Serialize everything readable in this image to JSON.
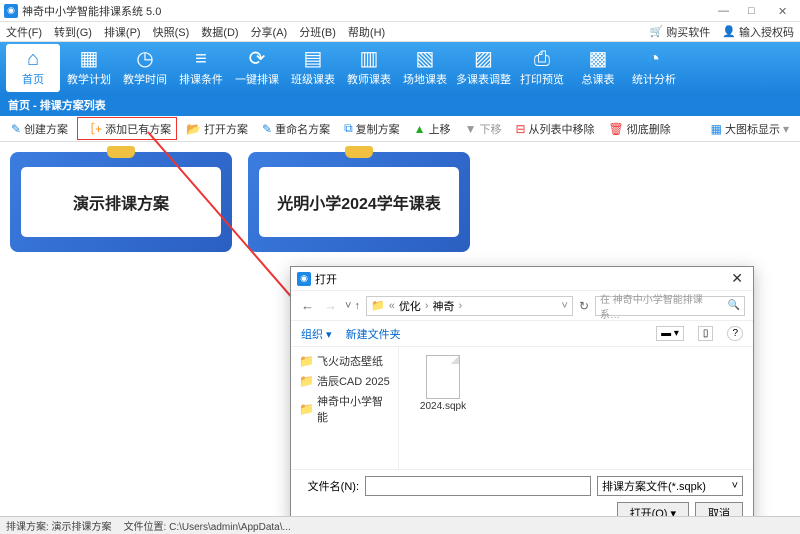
{
  "app": {
    "title": "神奇中小学智能排课系统 5.0"
  },
  "menu": {
    "file": "文件(F)",
    "goto": "转到(G)",
    "schedule": "排课(P)",
    "quick": "快照(S)",
    "data": "数据(D)",
    "share": "分享(A)",
    "league": "分班(B)",
    "help": "帮助(H)",
    "buy": "购买软件",
    "auth": "输入授权码"
  },
  "toolbar": [
    {
      "label": "首页",
      "icon": "⌂"
    },
    {
      "label": "教学计划",
      "icon": "▦"
    },
    {
      "label": "教学时间",
      "icon": "◷"
    },
    {
      "label": "排课条件",
      "icon": "≡"
    },
    {
      "label": "一键排课",
      "icon": "⟳"
    },
    {
      "label": "班级课表",
      "icon": "▤"
    },
    {
      "label": "教师课表",
      "icon": "▥"
    },
    {
      "label": "场地课表",
      "icon": "▧"
    },
    {
      "label": "多课表调整",
      "icon": "▨"
    },
    {
      "label": "打印预览",
      "icon": "⎙"
    },
    {
      "label": "总课表",
      "icon": "▩"
    },
    {
      "label": "统计分析",
      "icon": "◔"
    }
  ],
  "tab": "首页 - 排课方案列表",
  "subtoolbar": {
    "create": "创建方案",
    "addexisting": "添加已有方案",
    "open": "打开方案",
    "rename": "重命名方案",
    "copy": "复制方案",
    "moveup": "上移",
    "movedown": "下移",
    "removefromlist": "从列表中移除",
    "delete": "彻底删除",
    "iconview": "大图标显示"
  },
  "schemes": [
    {
      "name": "演示排课方案"
    },
    {
      "name": "光明小学2024学年课表"
    }
  ],
  "filedialog": {
    "title": "打开",
    "breadcrumb": {
      "folder1": "优化",
      "folder2": "神奇"
    },
    "searchPlaceholder": "在 神奇中小学智能排课系…",
    "organize": "组织",
    "newfolder": "新建文件夹",
    "tree": [
      "飞火动态壁纸",
      "浩辰CAD 2025",
      "神奇中小学智能"
    ],
    "file": "2024.sqpk",
    "filenameLabel": "文件名(N):",
    "filetype": "排课方案文件(*.sqpk)",
    "openBtn": "打开(O)",
    "cancelBtn": "取消"
  },
  "statusbar": {
    "scheme": "排课方案:  演示排课方案",
    "path": "文件位置:  C:\\Users\\admin\\AppData\\..."
  }
}
